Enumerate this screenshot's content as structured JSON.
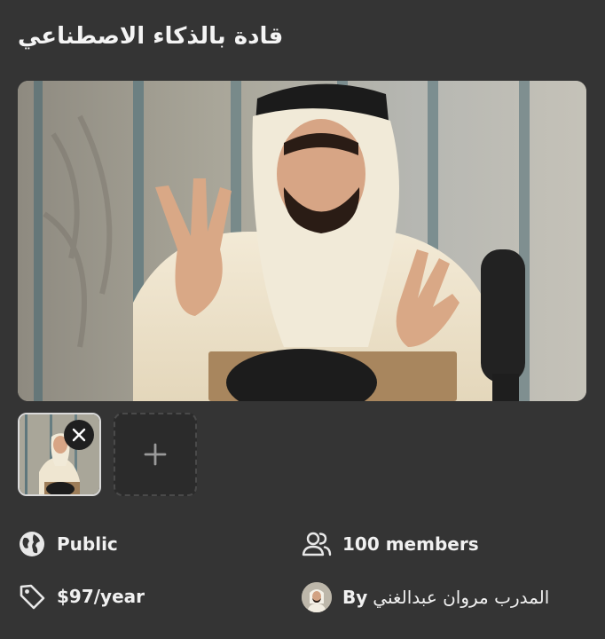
{
  "group": {
    "title": "قادة بالذكاء الاصطناعي"
  },
  "media": {
    "hero_image": "presenter-photo",
    "thumbnails": [
      {
        "image": "presenter-photo-thumb",
        "remove_icon": "close-icon"
      }
    ],
    "add_icon": "plus-icon"
  },
  "details": {
    "visibility": {
      "icon": "globe-icon",
      "label": "Public"
    },
    "members": {
      "icon": "users-icon",
      "label": "100 members"
    },
    "price": {
      "icon": "tag-icon",
      "label": "$97/year"
    },
    "owner": {
      "prefix": "By",
      "name": "المدرب مروان عبدالغني"
    }
  }
}
